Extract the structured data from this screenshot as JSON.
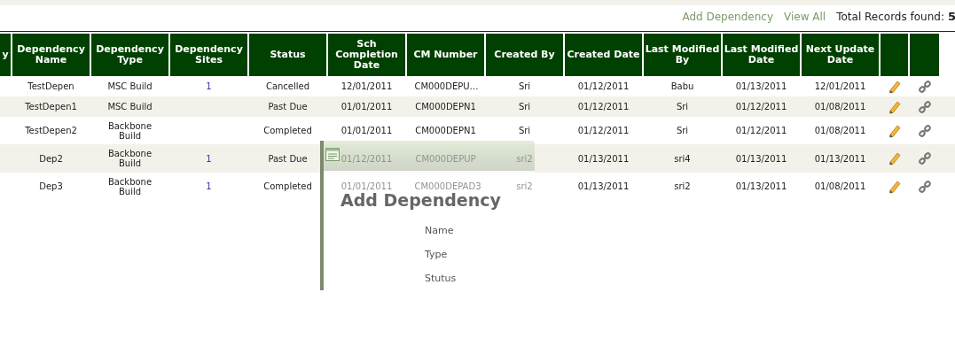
{
  "toolbar": {
    "links": [
      "Add Dependency",
      "View All"
    ],
    "total_label": "Total Records found:",
    "total_value": "5"
  },
  "table": {
    "columns": [
      "y",
      "Dependency Name",
      "Dependency Type",
      "Dependency Sites",
      "Status",
      "Sch Completion Date",
      "CM Number",
      "Created By",
      "Created Date",
      "Last Modified By",
      "Last Modified Date",
      "Next Update Date"
    ],
    "rows": [
      {
        "cells": [
          "",
          "TestDepen",
          "MSC Build",
          "1",
          "Cancelled",
          "12/01/2011",
          "CM000DEPU…",
          "Sri",
          "01/12/2011",
          "Babu",
          "01/13/2011",
          "12/01/2011"
        ]
      },
      {
        "cells": [
          "",
          "TestDepen1",
          "MSC Build",
          "",
          "Past Due",
          "01/01/2011",
          "CM000DEPN1",
          "Sri",
          "01/12/2011",
          "Sri",
          "01/12/2011",
          "01/08/2011"
        ]
      },
      {
        "cells": [
          "",
          "TestDepen2",
          "Backbone Build",
          "",
          "Completed",
          "01/01/2011",
          "CM000DEPN1",
          "Sri",
          "01/12/2011",
          "Sri",
          "01/12/2011",
          "01/08/2011"
        ]
      },
      {
        "cells": [
          "",
          "Dep2",
          "Backbone Build",
          "1",
          "Past Due",
          "01/12/2011",
          "CM000DEPUP",
          "sri2",
          "01/13/2011",
          "sri4",
          "01/13/2011",
          "01/13/2011"
        ]
      },
      {
        "cells": [
          "",
          "Dep3",
          "Backbone Build",
          "1",
          "Completed",
          "01/01/2011",
          "CM000DEPAD3",
          "sri2",
          "01/13/2011",
          "sri2",
          "01/13/2011",
          "01/08/2011"
        ]
      }
    ]
  },
  "dialog": {
    "title": "Add Dependency",
    "fields": [
      "Name",
      "Type",
      "Stutus"
    ]
  }
}
